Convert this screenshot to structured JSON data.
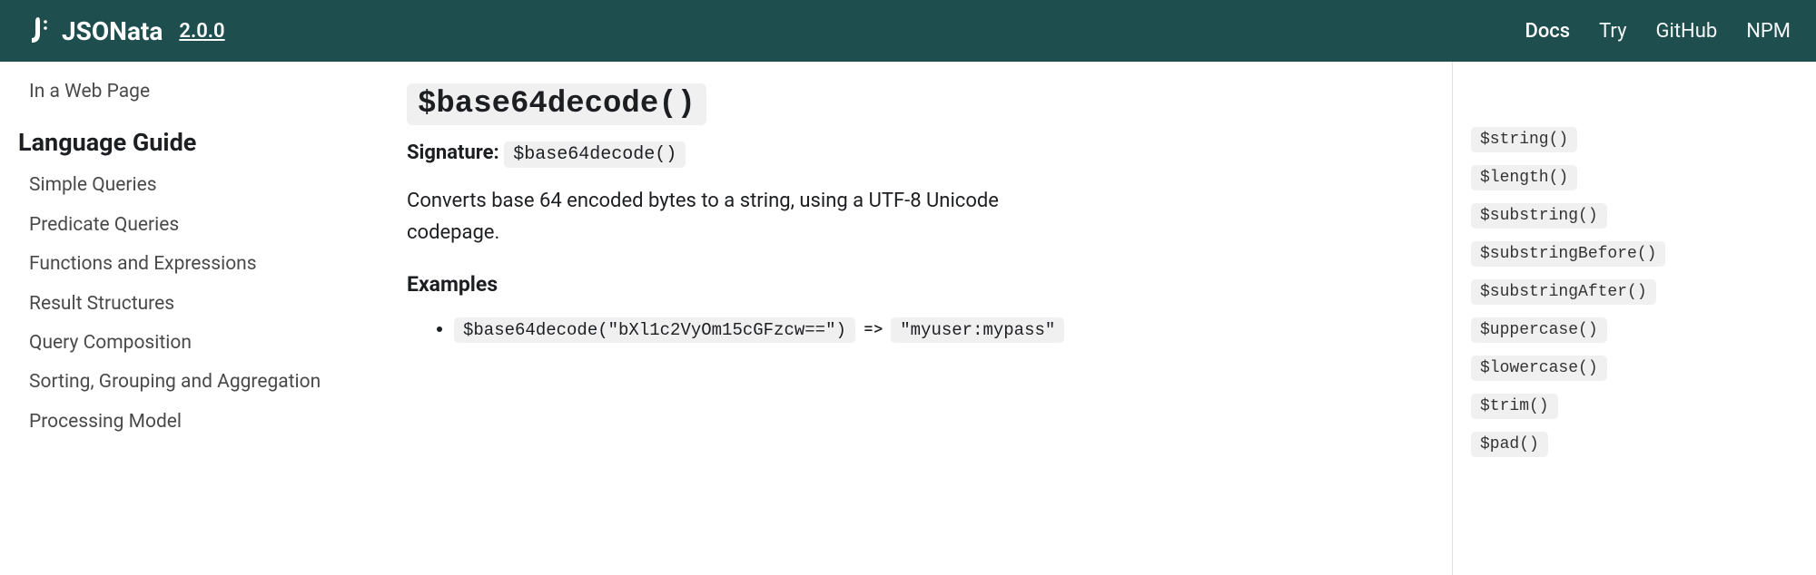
{
  "header": {
    "brand": "JSONata",
    "version": "2.0.0",
    "nav": [
      {
        "label": "Docs",
        "active": true
      },
      {
        "label": "Try",
        "active": false
      },
      {
        "label": "GitHub",
        "active": false
      },
      {
        "label": "NPM",
        "active": false
      }
    ]
  },
  "sidebar": {
    "topItems": [
      "In a Web Page"
    ],
    "heading": "Language Guide",
    "items": [
      "Simple Queries",
      "Predicate Queries",
      "Functions and Expressions",
      "Result Structures",
      "Query Composition",
      "Sorting, Grouping and Aggregation",
      "Processing Model"
    ]
  },
  "main": {
    "title": "$base64decode()",
    "signatureLabel": "Signature:",
    "signature": "$base64decode()",
    "description": "Converts base 64 encoded bytes to a string, using a UTF-8 Unicode codepage.",
    "examplesHeading": "Examples",
    "example": {
      "call": "$base64decode(\"bXl1c2VyOm15cGFzcw==\")",
      "arrow": "=>",
      "result": "\"myuser:mypass\""
    }
  },
  "toc": [
    "$string()",
    "$length()",
    "$substring()",
    "$substringBefore()",
    "$substringAfter()",
    "$uppercase()",
    "$lowercase()",
    "$trim()",
    "$pad()"
  ]
}
